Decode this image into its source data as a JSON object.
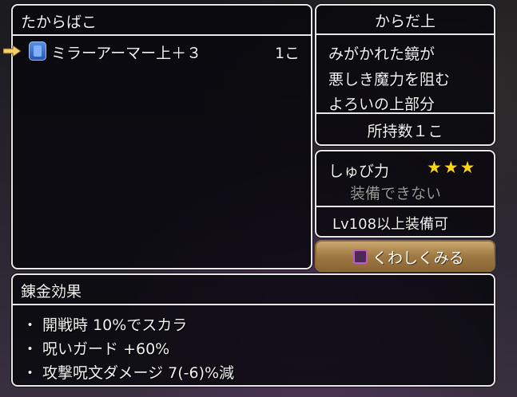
{
  "box": {
    "title": "たからばこ",
    "items": [
      {
        "name": "ミラーアーマー上＋３",
        "count": "1こ",
        "icon": "armor-icon"
      }
    ]
  },
  "description": {
    "slot": "からだ上",
    "lines": [
      "みがかれた鏡が",
      "悪しき魔力を阻む",
      "よろいの上部分"
    ],
    "owned": "所持数１こ"
  },
  "defense": {
    "label": "しゅび力",
    "stars": "★★★",
    "star_color": "#ffd21a",
    "status": "装備できない",
    "level_requirement": "Lv108以上装備可"
  },
  "details_button": {
    "label": "くわしくみる",
    "icon": "square-button-icon"
  },
  "alchemy": {
    "title": "錬金効果",
    "effects": [
      "・ 開戦時 10%でスカラ",
      "・ 呪いガード +60%",
      "・ 攻撃呪文ダメージ 7(-6)%減"
    ]
  }
}
